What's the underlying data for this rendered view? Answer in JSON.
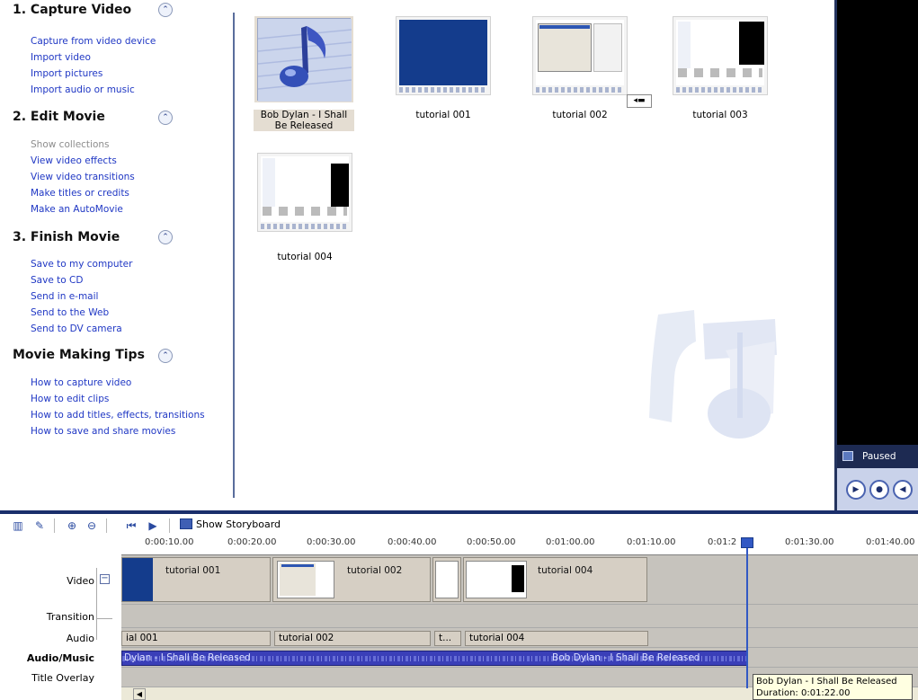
{
  "task_pane": {
    "sections": [
      {
        "title": "1. Capture Video",
        "links": [
          "Capture from video device",
          "Import video",
          "Import pictures",
          "Import audio or music"
        ]
      },
      {
        "title": "2. Edit Movie",
        "links": [
          "Show collections",
          "View video effects",
          "View video transitions",
          "Make titles or credits",
          "Make an AutoMovie"
        ]
      },
      {
        "title": "3. Finish Movie",
        "links": [
          "Save to my computer",
          "Save to CD",
          "Send in e-mail",
          "Send to the Web",
          "Send to DV camera"
        ]
      },
      {
        "title": "Movie Making Tips",
        "links": [
          "How to capture video",
          "How to edit clips",
          "How to add titles, effects, transitions",
          "How to save and share movies"
        ]
      }
    ]
  },
  "collection": {
    "clips": [
      {
        "label": "Bob Dylan - I Shall Be Released",
        "icon": "music-note-icon",
        "selected": true
      },
      {
        "label": "tutorial 001"
      },
      {
        "label": "tutorial 002"
      },
      {
        "label": "tutorial 003"
      },
      {
        "label": "tutorial 004"
      }
    ]
  },
  "monitor": {
    "status": "Paused",
    "controls": [
      "play-icon",
      "stop-icon",
      "previous-frame-icon"
    ]
  },
  "timeline": {
    "toolbar": {
      "show_storyboard": "Show Storyboard"
    },
    "ruler_ticks": [
      "0:00:10.00",
      "0:00:20.00",
      "0:00:30.00",
      "0:00:40.00",
      "0:00:50.00",
      "0:01:00.00",
      "0:01:10.00",
      "0:01:2",
      "0:01:30.00",
      "0:01:40.00"
    ],
    "track_labels": {
      "video": "Video",
      "transition": "Transition",
      "audio": "Audio",
      "audio_music": "Audio/Music",
      "title_overlay": "Title Overlay"
    },
    "video_clips": [
      "tutorial 001",
      "tutorial 002",
      "tutorial 004"
    ],
    "audio_clips": [
      "ial 001",
      "tutorial 002",
      "t...",
      "tutorial 004"
    ],
    "music_clip": {
      "text_left": "Dylan - I Shall Be Released",
      "text_right": "Bob Dylan - I Shall Be Released"
    },
    "tooltip": {
      "line1": "Bob Dylan - I Shall Be Released",
      "line2": "Duration: 0:01:22.00"
    }
  }
}
